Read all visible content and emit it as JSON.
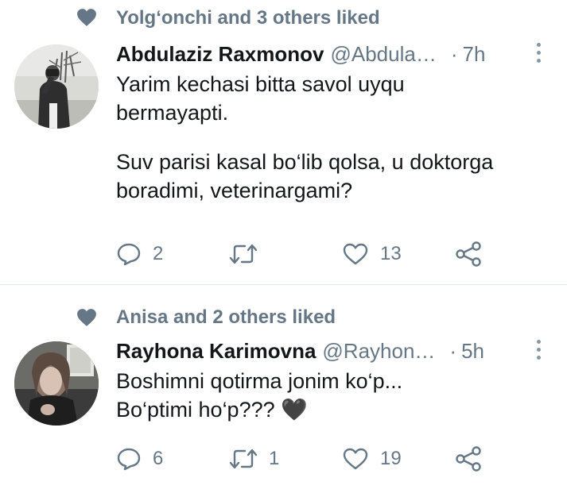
{
  "tweets": [
    {
      "social_context": "Yolg‘onchi and 3 others liked",
      "author_name": "Abdulaziz Raxmonov",
      "author_handle": "@Abdula…",
      "time_separator": "·",
      "time": "7h",
      "text_lines": [
        "Yarim kechasi bitta savol uyqu",
        "bermayapti.",
        "",
        "Suv parisi kasal bo‘lib qolsa, u doktorga",
        "boradimi, veterinargami?"
      ],
      "replies": "2",
      "retweets": "",
      "likes": "13"
    },
    {
      "social_context": "Anisa and 2 others liked",
      "author_name": "Rayhona Karimovna",
      "author_handle": "@Rayhon…",
      "time_separator": "·",
      "time": "5h",
      "text_lines": [
        "Boshimni qotirma jonim ko‘p...",
        "Bo‘ptimi ho‘p??? 🖤"
      ],
      "replies": "6",
      "retweets": "1",
      "likes": "19"
    }
  ],
  "colors": {
    "secondary_text": "#657786",
    "icon": "#657786",
    "divider": "#e1e8ed"
  },
  "icons": [
    "heart-icon",
    "more-icon",
    "reply-icon",
    "retweet-icon",
    "like-icon",
    "share-icon"
  ]
}
